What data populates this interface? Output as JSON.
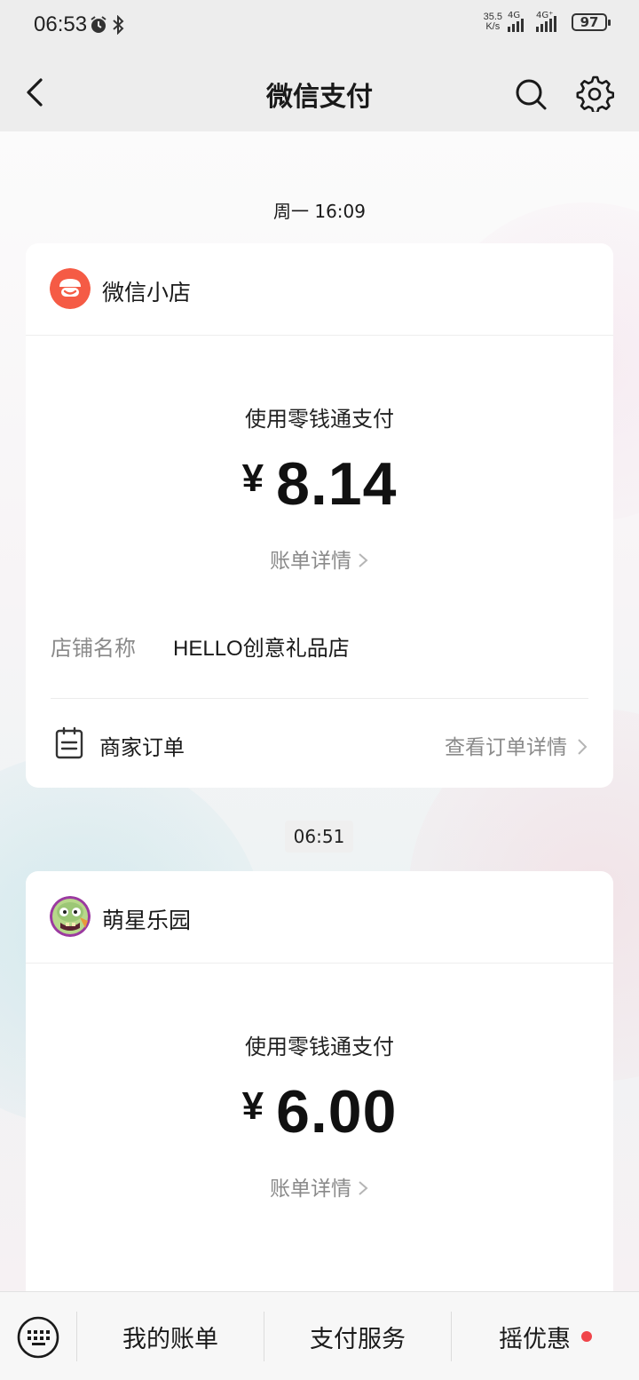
{
  "status_bar": {
    "time": "06:53",
    "net_speed_value": "35.5",
    "net_speed_unit": "K/s",
    "signal1_label": "4G",
    "signal2_label": "4G⁺",
    "battery": "97"
  },
  "nav": {
    "title": "微信支付"
  },
  "messages": [
    {
      "timestamp": "周一 16:09",
      "merchant": "微信小店",
      "pay_method": "使用零钱通支付",
      "currency": "¥",
      "amount": "8.14",
      "bill_link": "账单详情",
      "store_label": "店铺名称",
      "store_value": "HELLO创意礼品店",
      "order_label": "商家订单",
      "order_link": "查看订单详情"
    },
    {
      "timestamp": "06:51",
      "merchant": "萌星乐园",
      "pay_method": "使用零钱通支付",
      "currency": "¥",
      "amount": "6.00",
      "bill_link": "账单详情"
    }
  ],
  "bottom_bar": {
    "tab1": "我的账单",
    "tab2": "支付服务",
    "tab3": "摇优惠"
  },
  "colors": {
    "accent_orange": "#f55b45",
    "red_dot": "#f0454a",
    "secondary_text": "#8a8a8a"
  }
}
